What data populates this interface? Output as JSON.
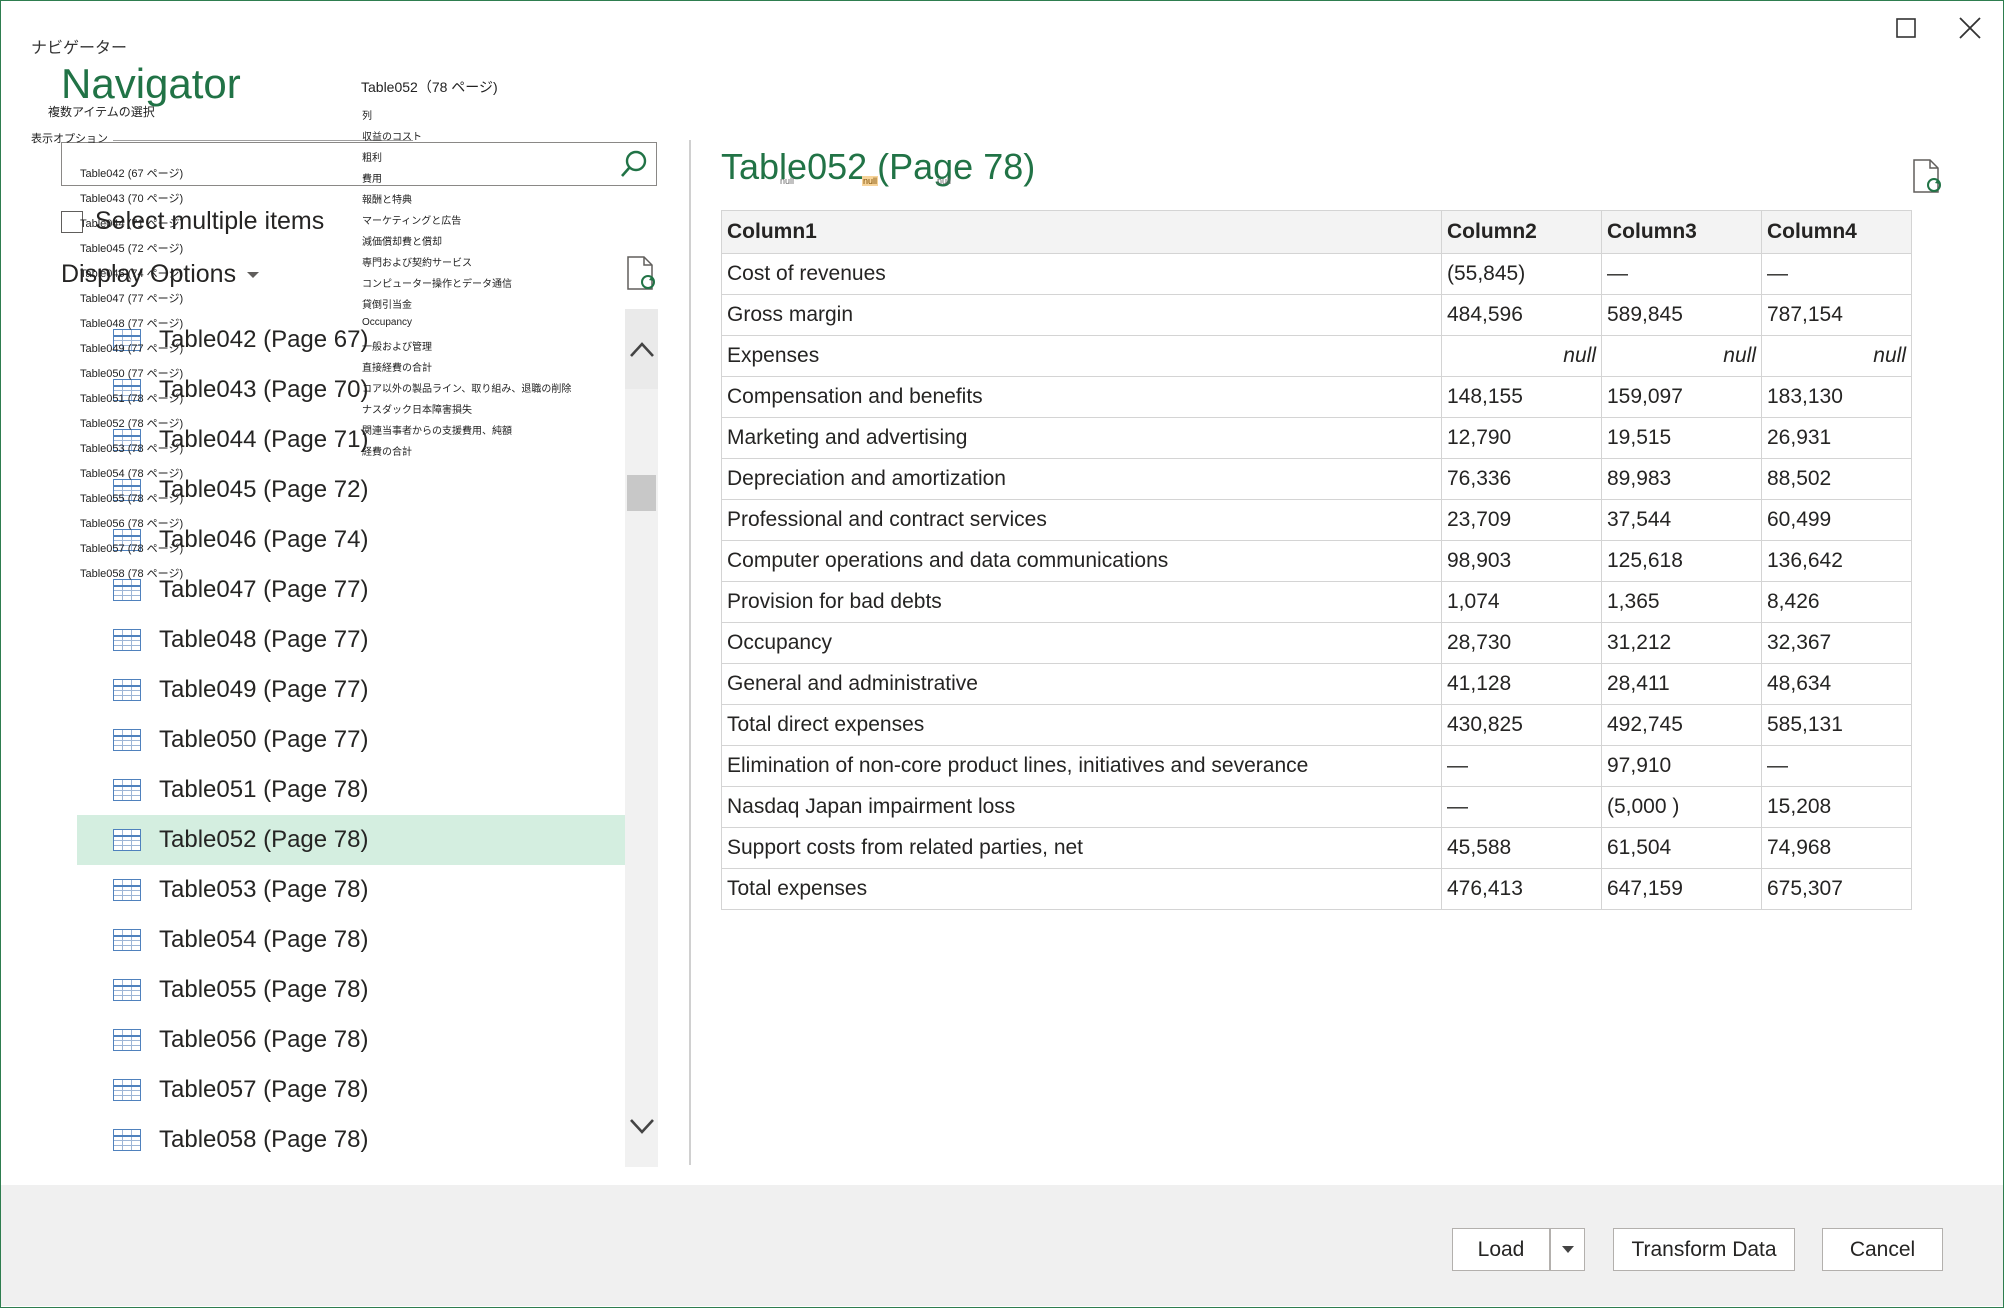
{
  "window": {
    "title": "ナビゲーター"
  },
  "left": {
    "heading": "Navigator",
    "select_multiple_label": "Select multiple items",
    "display_options_label": "Display Options",
    "items": [
      "Table042 (Page 67)",
      "Table043 (Page 70)",
      "Table044 (Page 71)",
      "Table045 (Page 72)",
      "Table046 (Page 74)",
      "Table047 (Page 77)",
      "Table048 (Page 77)",
      "Table049 (Page 77)",
      "Table050 (Page 77)",
      "Table051 (Page 78)",
      "Table052 (Page 78)",
      "Table053 (Page 78)",
      "Table054 (Page 78)",
      "Table055 (Page 78)",
      "Table056 (Page 78)",
      "Table057 (Page 78)",
      "Table058 (Page 78)"
    ],
    "selected_index": 10
  },
  "overlay": {
    "select_multiple_jp": "複数アイテムの選択",
    "display_options_jp": "表示オプション",
    "items_jp": [
      "Table042 (67 ページ)",
      "Table043 (70 ページ)",
      "Table044 (71 ページ)",
      "Table045 (72 ページ)",
      "Table046 (74 ページ)",
      "Table047 (77 ページ)",
      "Table048 (77 ページ)",
      "Table049 (77 ページ)",
      "Table050 (77 ページ)",
      "Table051 (78 ページ)",
      "Table052 (78 ページ)",
      "Table053 (78 ページ)",
      "Table054 (78 ページ)",
      "Table055 (78 ページ)",
      "Table056 (78 ページ)",
      "Table057 (78 ページ)",
      "Table058 (78 ページ)"
    ],
    "preview_title_jp": "Table052（78 ページ)",
    "rows_jp": [
      "列",
      "収益のコスト",
      "粗利",
      "費用",
      "報酬と特典",
      "マーケティングと広告",
      "減価償却費と償却",
      "専門および契約サービス",
      "コンピューター操作とデータ通信",
      "貸倒引当金",
      "Occupancy",
      "一般および管理",
      "直接経費の合計",
      "コア以外の製品ライン、取り組み、退職の削除",
      "ナスダック日本障害損失",
      "関連当事者からの支援費用、純額",
      "経費の合計"
    ],
    "null_text": "null"
  },
  "preview": {
    "title": "Table052 (Page 78)",
    "columns": [
      "Column1",
      "Column2",
      "Column3",
      "Column4"
    ],
    "rows": [
      [
        "Cost of revenues",
        "(55,845)",
        "—",
        "—"
      ],
      [
        "Gross margin",
        "484,596",
        "589,845",
        "787,154"
      ],
      [
        "Expenses",
        "null",
        "null",
        "null"
      ],
      [
        "Compensation and benefits",
        "148,155",
        "159,097",
        "183,130"
      ],
      [
        "Marketing and advertising",
        "12,790",
        "19,515",
        "26,931"
      ],
      [
        "Depreciation and amortization",
        "76,336",
        "89,983",
        "88,502"
      ],
      [
        "Professional and contract services",
        "23,709",
        "37,544",
        "60,499"
      ],
      [
        "Computer operations and data communications",
        "98,903",
        "125,618",
        "136,642"
      ],
      [
        "Provision for bad debts",
        "1,074",
        "1,365",
        "8,426"
      ],
      [
        "Occupancy",
        "28,730",
        "31,212",
        "32,367"
      ],
      [
        "General and administrative",
        "41,128",
        "28,411",
        "48,634"
      ],
      [
        "Total direct expenses",
        "430,825",
        "492,745",
        "585,131"
      ],
      [
        "Elimination of non-core product lines, initiatives and severance",
        "—",
        "97,910",
        "—"
      ],
      [
        "Nasdaq Japan impairment loss",
        "—",
        "(5,000 )",
        "15,208"
      ],
      [
        "Support costs from related parties, net",
        "45,588",
        "61,504",
        "74,968"
      ],
      [
        "Total expenses",
        "476,413",
        "647,159",
        "675,307"
      ]
    ]
  },
  "footer": {
    "load_label": "Load",
    "transform_label": "Transform Data",
    "cancel_label": "Cancel"
  },
  "colors": {
    "accent": "#217346",
    "selected_row": "#d4eee0",
    "footer_bg": "#f0f0f0"
  }
}
